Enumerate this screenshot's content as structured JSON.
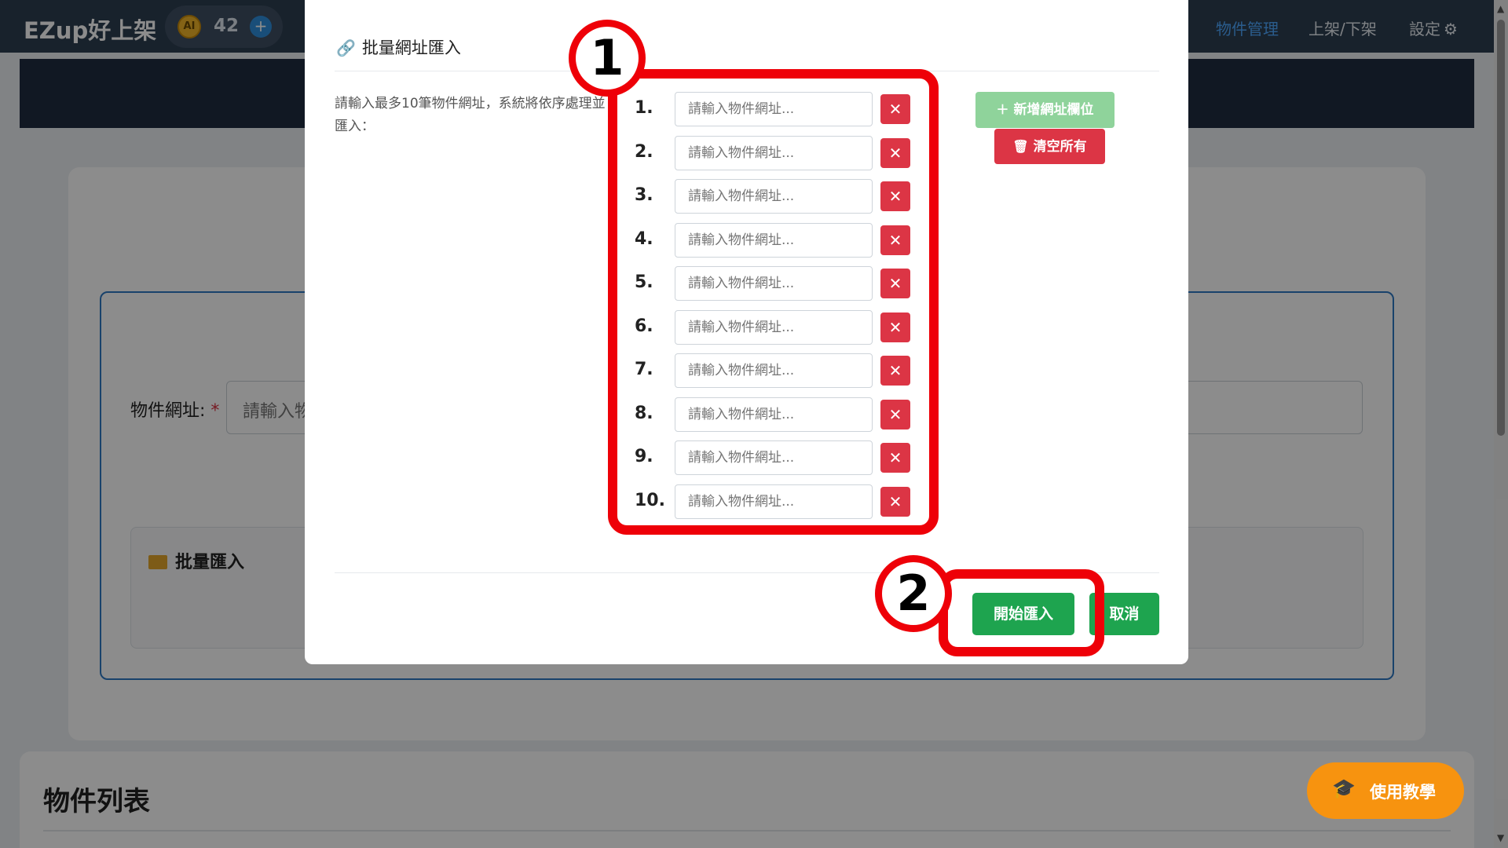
{
  "navbar": {
    "brand": "EZup好上架",
    "ai_badge": "AI",
    "ai_count": "42",
    "ai_plus": "+",
    "links": [
      "物件管理",
      "上架/下架",
      "設定"
    ],
    "active_link": "物件管理"
  },
  "background": {
    "field_label": "物件網址:",
    "required_mark": "*",
    "field_placeholder": "請輸入物",
    "batch_title": "批量匯入",
    "list_title": "物件列表"
  },
  "help_button": {
    "label": "使用教學"
  },
  "modal": {
    "title": "批量網址匯入",
    "description": "請輸入最多10筆物件網址，系統將依序處理並匯入：",
    "url_rows": [
      {
        "num": "1.",
        "placeholder": "請輸入物件網址..."
      },
      {
        "num": "2.",
        "placeholder": "請輸入物件網址..."
      },
      {
        "num": "3.",
        "placeholder": "請輸入物件網址..."
      },
      {
        "num": "4.",
        "placeholder": "請輸入物件網址..."
      },
      {
        "num": "5.",
        "placeholder": "請輸入物件網址..."
      },
      {
        "num": "6.",
        "placeholder": "請輸入物件網址..."
      },
      {
        "num": "7.",
        "placeholder": "請輸入物件網址..."
      },
      {
        "num": "8.",
        "placeholder": "請輸入物件網址..."
      },
      {
        "num": "9.",
        "placeholder": "請輸入物件網址..."
      },
      {
        "num": "10.",
        "placeholder": "請輸入物件網址..."
      }
    ],
    "add_button": "新增網址欄位",
    "clear_button": "清空所有",
    "start_button": "開始匯入",
    "cancel_button": "取消"
  },
  "annotations": {
    "badge_1": "1",
    "badge_2": "2",
    "color": "#ee0008"
  },
  "colors": {
    "navbar": "#2d3e50",
    "primary_green": "#1ea44f",
    "danger_red": "#dc3545",
    "accent_orange": "#f7930f",
    "link_blue": "#4ea8ff"
  }
}
